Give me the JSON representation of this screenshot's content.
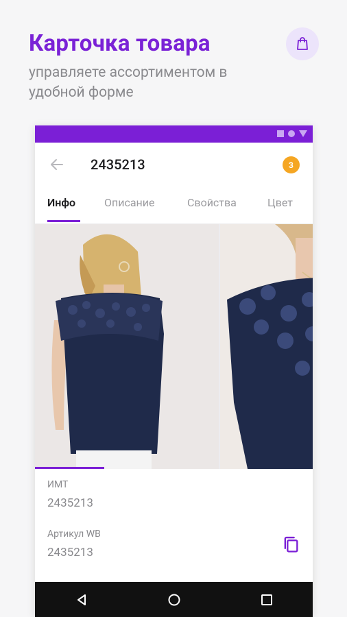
{
  "promo": {
    "title": "Карточка товара",
    "subtitle": "управляете ассортиментом в удобной форме"
  },
  "app": {
    "product_id": "2435213",
    "badge_count": "3",
    "tabs": [
      "Инфо",
      "Описание",
      "Свойства",
      "Цвет"
    ],
    "active_tab": "Инфо",
    "fields": [
      {
        "label": "ИМТ",
        "value": "2435213"
      },
      {
        "label": "Артикул WB",
        "value": "2435213"
      }
    ]
  },
  "colors": {
    "accent": "#7b1fd6",
    "badge": "#f5a623",
    "navbar": "#111111"
  },
  "icons": {
    "header": "shopping-bag-icon",
    "appbar_back": "arrow-back-icon",
    "copy": "copy-icon",
    "nav": [
      "back-triangle-icon",
      "home-circle-icon",
      "recents-square-icon"
    ]
  }
}
